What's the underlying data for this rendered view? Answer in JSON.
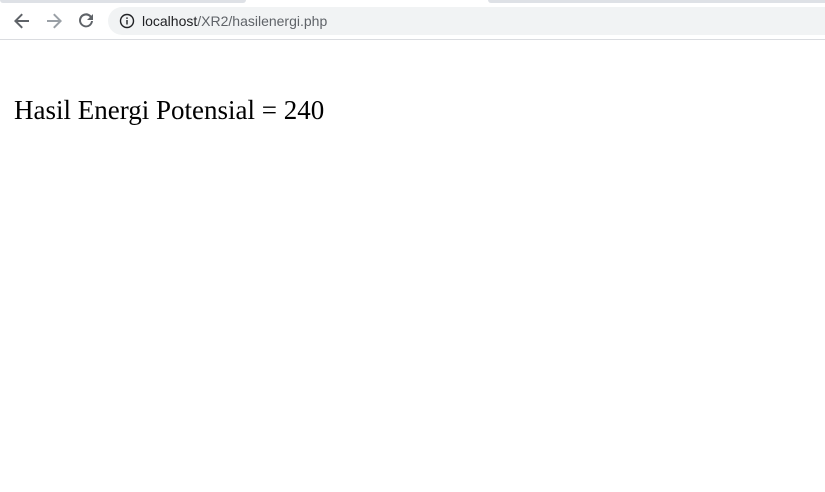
{
  "browser": {
    "address_bar": {
      "host": "localhost",
      "path": "/XR2/hasilenergi.php"
    },
    "icons": {
      "back": "arrow-left-icon",
      "forward": "arrow-right-icon",
      "reload": "reload-icon",
      "site_info": "info-circle-icon"
    },
    "colors": {
      "toolbar_bg": "#ffffff",
      "omnibox_bg": "#f1f3f4",
      "icon_active": "#5f6368",
      "icon_disabled": "#9aa0a6"
    }
  },
  "page": {
    "result_text": "Hasil Energi Potensial = 240"
  }
}
